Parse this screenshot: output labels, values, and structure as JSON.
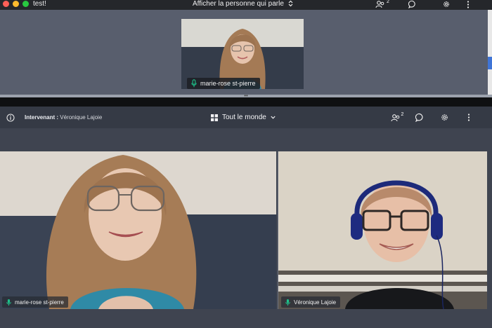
{
  "window": {
    "title": "test!",
    "layout_selector": "Afficher la personne qui parle"
  },
  "top_toolbar": {
    "participants_badge": "2"
  },
  "thumbnail": {
    "participant_name": "marie-rose st-pierre"
  },
  "meeting_bar": {
    "speaker_prefix": "Intervenant :",
    "speaker_name": " Véronique Lajoie",
    "view_selector": "Tout le monde",
    "participants_badge": "2"
  },
  "tiles": [
    {
      "participant_name": "marie-rose st-pierre"
    },
    {
      "participant_name": "Véronique Lajoie"
    }
  ],
  "icons": {
    "window_close": "close-dot",
    "window_minimize": "minimize-dot",
    "window_zoom": "zoom-dot",
    "layout_chevron": "updown-chevron-icon",
    "participants": "participants-icon",
    "chat": "chat-icon",
    "settings": "gear-icon",
    "more": "more-vertical-icon",
    "info": "info-icon",
    "grid": "grid-icon",
    "dropdown": "chevron-down-icon",
    "microphone": "microphone-icon"
  },
  "colors": {
    "mic_active": "#1ec28b",
    "close": "#ff5f57",
    "minimize": "#febc2e",
    "zoom": "#28c840"
  }
}
